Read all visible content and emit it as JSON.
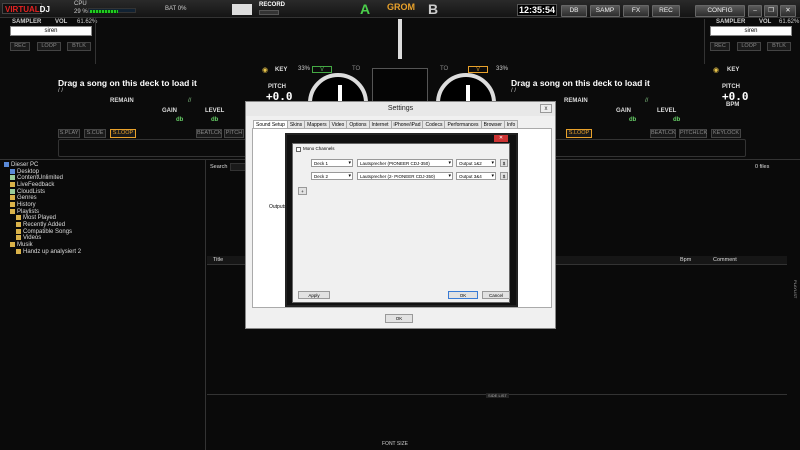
{
  "top": {
    "logo_prefix": "VIRTUAL",
    "logo_suffix": "DJ",
    "cpu_label": "CPU",
    "cpu_value": "29 %",
    "bat_label": "BAT 0%",
    "record_label": "RECORD",
    "deck_a": "A",
    "deck_b": "B",
    "grom_label": "GROM",
    "time": "12:35:54",
    "btn_db": "DB",
    "btn_samp": "SAMP",
    "btn_fx": "FX",
    "btn_rec": "REC",
    "btn_config": "CONFIG"
  },
  "left_deck": {
    "sampler": "SAMPLER",
    "vol": "VOL",
    "vol_value": "61.62%",
    "sample_name": "siren",
    "btns": [
      "REC",
      "LOOP",
      "BTLK"
    ],
    "drag_text": "Drag a song on this deck to load it",
    "slashes": "/ /",
    "remain": "REMAIN",
    "gain": "GAIN",
    "level": "LEVEL",
    "db": "db",
    "db2": "db",
    "quote": "//",
    "key": "KEY",
    "pitch": "PITCH",
    "pitch_value": "+0.0",
    "pct": "33%",
    "v_label": "V",
    "to_label": "TO",
    "tabs": [
      "S.PLAY",
      "S.CUE",
      "S.LOOP"
    ],
    "tabs_right": [
      "BEATLCK",
      "PITCH"
    ]
  },
  "right_deck": {
    "sampler": "SAMPLER",
    "vol": "VOL",
    "vol_value": "61.62%",
    "sample_name": "siren",
    "btns": [
      "REC",
      "LOOP",
      "BTLK"
    ],
    "drag_text": "Drag a song on this deck to load it",
    "slashes": "/ /",
    "remain": "REMAIN",
    "gain": "GAIN",
    "level": "LEVEL",
    "db": "db",
    "db2": "db",
    "quote": "//",
    "key": "KEY",
    "pitch": "PITCH",
    "pitch_value": "+0.0",
    "bpm": "BPM",
    "pct": "33%",
    "v_label": "V",
    "to_label": "TO",
    "loop_tab": "S.LOOP",
    "tabs_right": [
      "BEATLCK",
      "PITCHLCK",
      "KEYLOCK"
    ]
  },
  "browser": {
    "tree": [
      {
        "label": "Dieser PC",
        "icon": "computer-icon"
      },
      {
        "label": "Desktop",
        "icon": "folder-icon"
      },
      {
        "label": "ContentUnlimited",
        "icon": "cloud-icon"
      },
      {
        "label": "LiveFeedback",
        "icon": "folder-icon"
      },
      {
        "label": "CloudLists",
        "icon": "cloud-icon"
      },
      {
        "label": "Genres",
        "icon": "folder-icon"
      },
      {
        "label": "History",
        "icon": "folder-icon"
      },
      {
        "label": "Playlists",
        "icon": "folder-icon"
      },
      {
        "label": "Most Played",
        "icon": "folder-icon"
      },
      {
        "label": "Recently Added",
        "icon": "folder-icon"
      },
      {
        "label": "Compatible Songs",
        "icon": "folder-icon"
      },
      {
        "label": "Videos",
        "icon": "folder-icon"
      },
      {
        "label": "Musik",
        "icon": "folder-icon"
      },
      {
        "label": "Handz up analysiert 2",
        "icon": "folder-icon"
      }
    ],
    "search_label": "Search",
    "files_count": "0 files",
    "col_title": "Title",
    "col_bpm": "Bpm",
    "col_comment": "Comment",
    "sidelist": "SIDE LIST",
    "font_size": "FONT SIZE",
    "playlist_tab": "PLAYLIST"
  },
  "settings_dialog": {
    "title": "Settings",
    "tabs": [
      "Sound Setup",
      "Skins",
      "Mappers",
      "Video",
      "Options",
      "Internet",
      "iPhone/iPad",
      "Codecs",
      "Performances",
      "Browser",
      "Info"
    ],
    "outputs_label": "Outputs",
    "mono_channels": "Mono Channels",
    "rows": [
      {
        "deck": "Deck 1",
        "device": "Lautsprecher (PIONEER CDJ-350)",
        "output": "Output 1&2"
      },
      {
        "deck": "Deck 2",
        "device": "Lautsprecher (2- PIONEER CDJ-350)",
        "output": "Output 3&4"
      }
    ],
    "add_btn": "+",
    "row_btn": "$",
    "apply": "Apply",
    "ok_inner": "OK",
    "cancel": "Cancel",
    "ok": "OK",
    "close_glyph": "x"
  }
}
